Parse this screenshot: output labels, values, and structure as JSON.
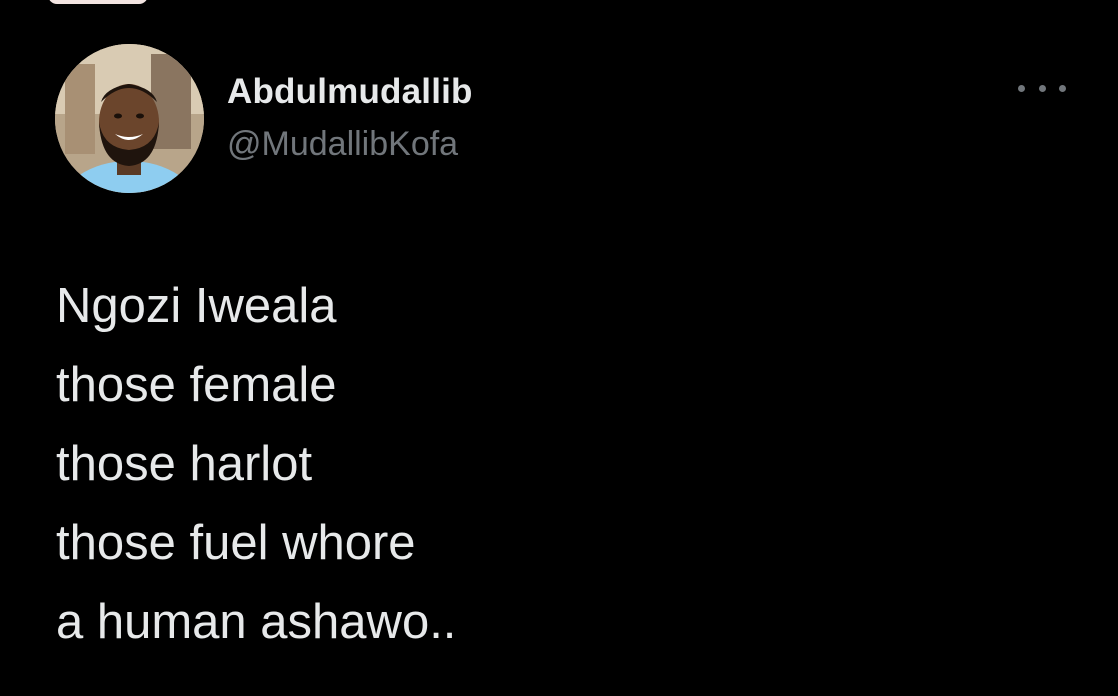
{
  "tweet": {
    "author": {
      "display_name": "Abdulmudallib",
      "handle": "@MudallibKofa",
      "avatar_icon": "profile-photo"
    },
    "more_icon": "more-options-icon",
    "text_lines": [
      "Ngozi Iweala",
      "those female",
      "those harlot",
      "those fuel whore",
      "a human ashawo.."
    ]
  },
  "colors": {
    "background": "#000000",
    "text_primary": "#e7e9ea",
    "text_secondary": "#71767b"
  }
}
